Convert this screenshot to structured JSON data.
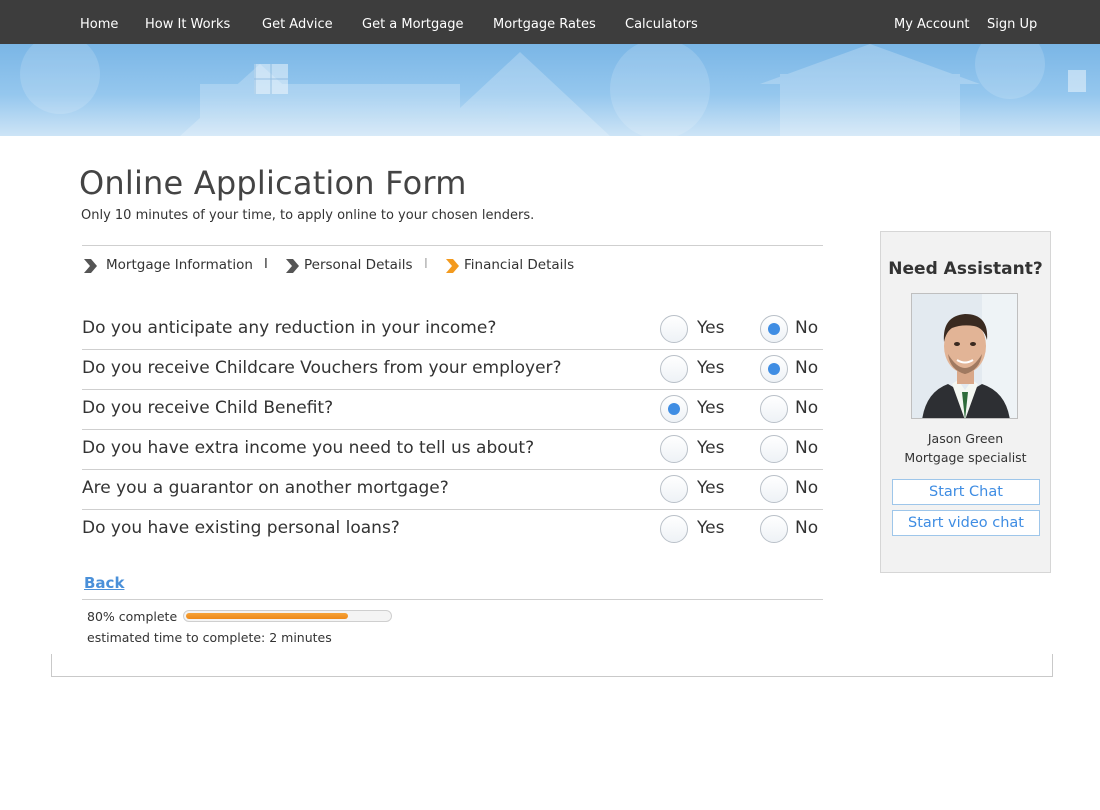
{
  "nav": {
    "left": [
      "Home",
      "How It Works",
      "Get Advice",
      "Get a Mortgage",
      "Mortgage Rates",
      "Calculators"
    ],
    "right": [
      "My Account",
      "Sign Up"
    ]
  },
  "page": {
    "title": "Online Application Form",
    "subtitle": "Only 10 minutes of your time, to apply online to your chosen lenders."
  },
  "steps": [
    {
      "label": "Mortgage Information",
      "state": "done"
    },
    {
      "label": "Personal Details",
      "state": "done"
    },
    {
      "label": "Financial Details",
      "state": "current"
    }
  ],
  "step_separator": "I",
  "options": {
    "yes": "Yes",
    "no": "No"
  },
  "questions": [
    {
      "text": "Do you anticipate any reduction in your income?",
      "answer": "no"
    },
    {
      "text": "Do you receive Childcare Vouchers from your employer?",
      "answer": "no"
    },
    {
      "text": "Do you receive Child Benefit?",
      "answer": "yes"
    },
    {
      "text": "Do you have extra income you need to tell us about?",
      "answer": null
    },
    {
      "text": "Are you a guarantor on another mortgage?",
      "answer": null
    },
    {
      "text": "Do you have existing personal loans?",
      "answer": null
    }
  ],
  "back_label": "Back",
  "progress": {
    "label": "80% complete",
    "percent": 80,
    "eta": "estimated time to complete: 2 minutes"
  },
  "assistant": {
    "heading": "Need Assistant?",
    "name": "Jason Green",
    "role": "Mortgage specialist",
    "chat_label": "Start Chat",
    "video_label": "Start video chat"
  },
  "colors": {
    "nav_bg": "#3d3d3d",
    "accent": "#3f8de3",
    "progress": "#ee8a1a",
    "step_current": "#f39a1e",
    "step_done": "#555555"
  }
}
